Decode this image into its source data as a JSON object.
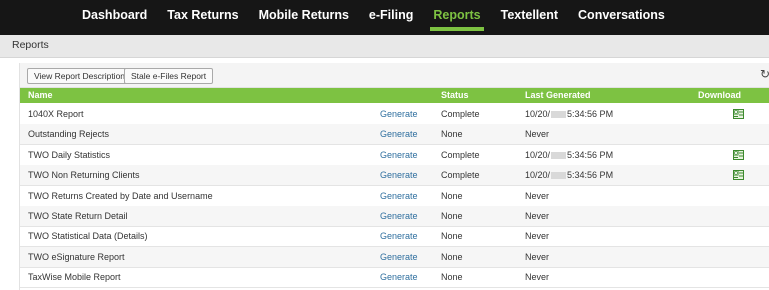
{
  "nav": {
    "items": [
      {
        "label": "Dashboard"
      },
      {
        "label": "Tax Returns"
      },
      {
        "label": "Mobile Returns"
      },
      {
        "label": "e-Filing"
      },
      {
        "label": "Reports"
      },
      {
        "label": "Textellent"
      },
      {
        "label": "Conversations"
      }
    ],
    "active": "Reports",
    "active_color": "#7dc242"
  },
  "page": {
    "title": "Reports"
  },
  "toolbar": {
    "view_descriptions_label": "View Report Descriptions",
    "stale_efiles_label": "Stale e-Files Report",
    "refresh_icon": "refresh-icon"
  },
  "table": {
    "header_color": "#7dc242",
    "columns": {
      "name": "Name",
      "status": "Status",
      "last_generated": "Last Generated",
      "download": "Download"
    },
    "generate_label": "Generate",
    "rows": [
      {
        "name": "1040X Report",
        "status": "Complete",
        "date_prefix": "10/20/",
        "time": "5:34:56 PM",
        "last": "",
        "download": true
      },
      {
        "name": "Outstanding Rejects",
        "status": "None",
        "date_prefix": "",
        "time": "",
        "last": "Never",
        "download": false
      },
      {
        "name": "TWO Daily Statistics",
        "status": "Complete",
        "date_prefix": "10/20/",
        "time": "5:34:56 PM",
        "last": "",
        "download": true
      },
      {
        "name": "TWO Non Returning Clients",
        "status": "Complete",
        "date_prefix": "10/20/",
        "time": "5:34:56 PM",
        "last": "",
        "download": true
      },
      {
        "name": "TWO Returns Created by Date and Username",
        "status": "None",
        "date_prefix": "",
        "time": "",
        "last": "Never",
        "download": false
      },
      {
        "name": "TWO State Return Detail",
        "status": "None",
        "date_prefix": "",
        "time": "",
        "last": "Never",
        "download": false
      },
      {
        "name": "TWO Statistical Data (Details)",
        "status": "None",
        "date_prefix": "",
        "time": "",
        "last": "Never",
        "download": false
      },
      {
        "name": "TWO eSignature Report",
        "status": "None",
        "date_prefix": "",
        "time": "",
        "last": "Never",
        "download": false
      },
      {
        "name": "TaxWise Mobile Report",
        "status": "None",
        "date_prefix": "",
        "time": "",
        "last": "Never",
        "download": false
      }
    ]
  }
}
